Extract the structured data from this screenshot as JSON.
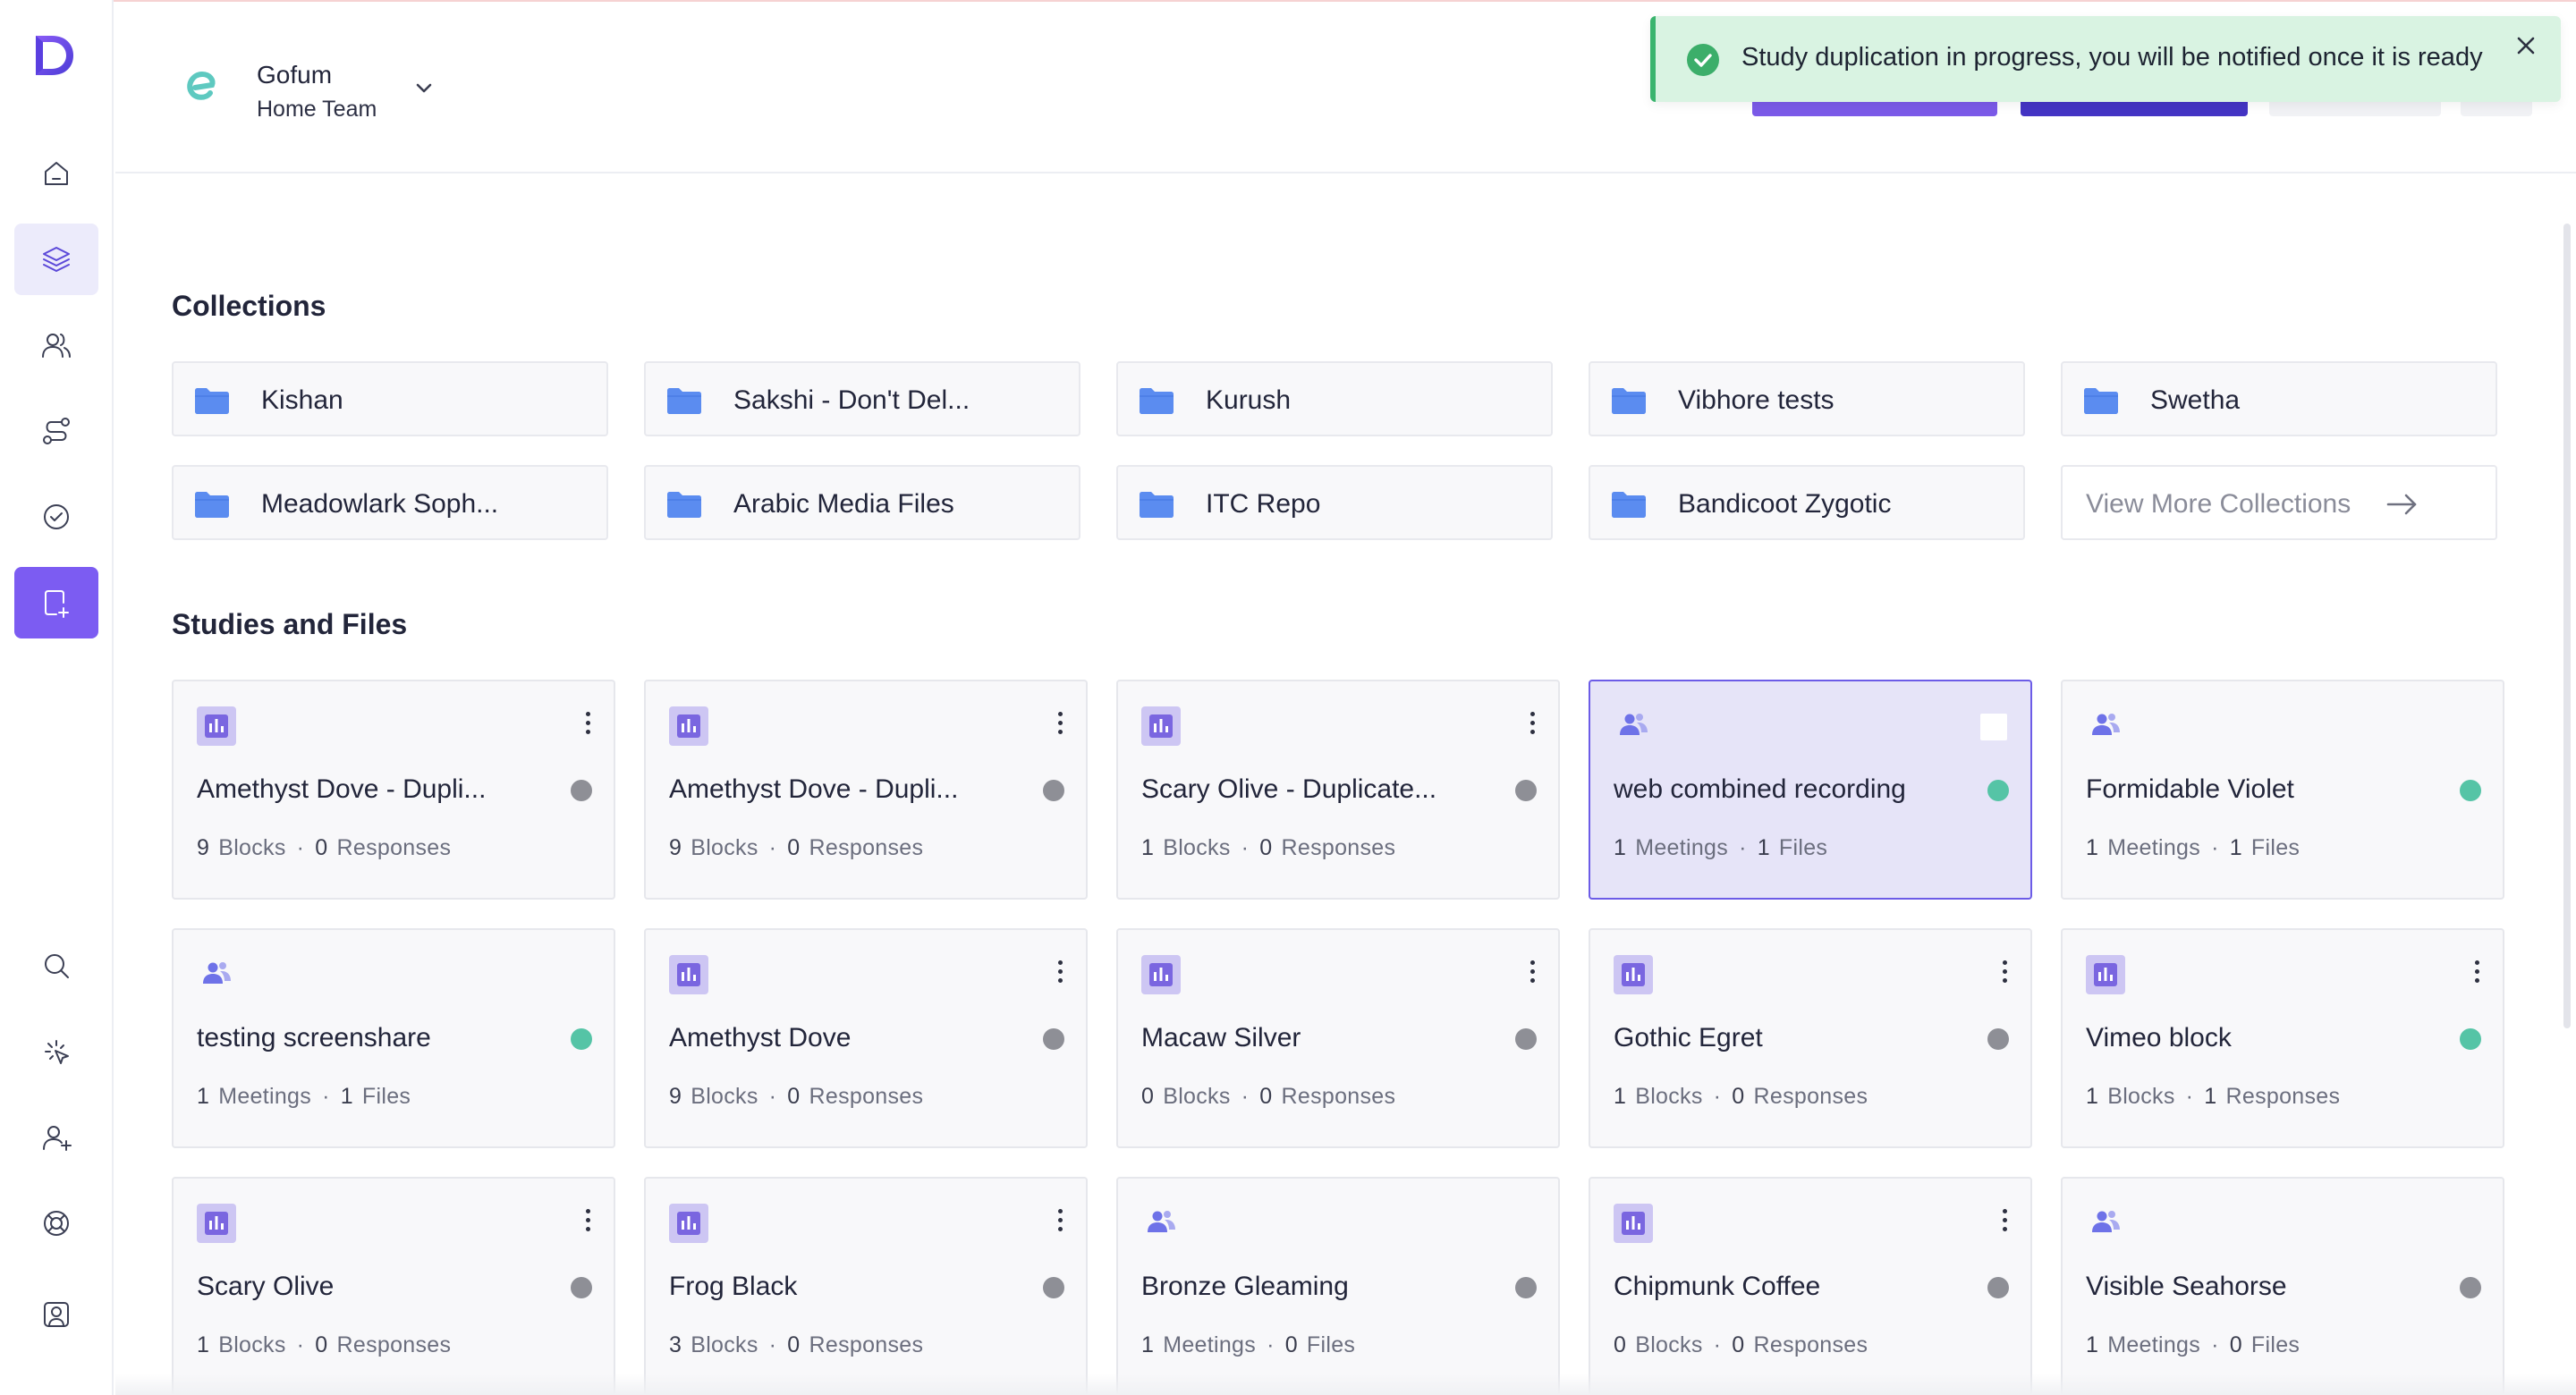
{
  "app": {
    "logo_letter": "D"
  },
  "team": {
    "name": "Gofum",
    "sub": "Home Team"
  },
  "toast": {
    "message": "Study duplication in progress, you will be notified once it is ready"
  },
  "sections": {
    "collections_title": "Collections",
    "studies_title": "Studies and Files"
  },
  "collections": [
    {
      "label": "Kishan"
    },
    {
      "label": "Sakshi - Don't Del..."
    },
    {
      "label": "Kurush"
    },
    {
      "label": "Vibhore tests"
    },
    {
      "label": "Swetha"
    },
    {
      "label": "Meadowlark Soph..."
    },
    {
      "label": "Arabic Media Files"
    },
    {
      "label": "ITC Repo"
    },
    {
      "label": "Bandicoot Zygotic"
    }
  ],
  "view_more": {
    "label": "View More Collections"
  },
  "colors": {
    "accent": "#7c5cf2",
    "dot_gray": "#8e8f96",
    "dot_green": "#55c4a6",
    "toast_bg": "#d9f3e2"
  },
  "studies": [
    {
      "title": "Amethyst Dove - Dupli...",
      "type": "chart-icon",
      "n1": "9",
      "u1": "Blocks",
      "n2": "0",
      "u2": "Responses",
      "status": "gray"
    },
    {
      "title": "Amethyst Dove - Dupli...",
      "type": "chart-icon",
      "n1": "9",
      "u1": "Blocks",
      "n2": "0",
      "u2": "Responses",
      "status": "gray"
    },
    {
      "title": "Scary Olive - Duplicate...",
      "type": "chart-icon",
      "n1": "1",
      "u1": "Blocks",
      "n2": "0",
      "u2": "Responses",
      "status": "gray"
    },
    {
      "title": "web combined recording",
      "type": "people-icon",
      "n1": "1",
      "u1": "Meetings",
      "n2": "1",
      "u2": "Files",
      "status": "green",
      "selected": true
    },
    {
      "title": "Formidable Violet",
      "type": "people-icon",
      "n1": "1",
      "u1": "Meetings",
      "n2": "1",
      "u2": "Files",
      "status": "green"
    },
    {
      "title": "testing screenshare",
      "type": "people-icon",
      "n1": "1",
      "u1": "Meetings",
      "n2": "1",
      "u2": "Files",
      "status": "green"
    },
    {
      "title": "Amethyst Dove",
      "type": "chart-icon",
      "n1": "9",
      "u1": "Blocks",
      "n2": "0",
      "u2": "Responses",
      "status": "gray"
    },
    {
      "title": "Macaw Silver",
      "type": "chart-icon",
      "n1": "0",
      "u1": "Blocks",
      "n2": "0",
      "u2": "Responses",
      "status": "gray"
    },
    {
      "title": "Gothic Egret",
      "type": "chart-icon",
      "n1": "1",
      "u1": "Blocks",
      "n2": "0",
      "u2": "Responses",
      "status": "gray"
    },
    {
      "title": "Vimeo block",
      "type": "chart-icon",
      "n1": "1",
      "u1": "Blocks",
      "n2": "1",
      "u2": "Responses",
      "status": "green"
    },
    {
      "title": "Scary Olive",
      "type": "chart-icon",
      "n1": "1",
      "u1": "Blocks",
      "n2": "0",
      "u2": "Responses",
      "status": "gray"
    },
    {
      "title": "Frog Black",
      "type": "chart-icon",
      "n1": "3",
      "u1": "Blocks",
      "n2": "0",
      "u2": "Responses",
      "status": "gray"
    },
    {
      "title": "Bronze Gleaming",
      "type": "people-icon",
      "n1": "1",
      "u1": "Meetings",
      "n2": "0",
      "u2": "Files",
      "status": "gray"
    },
    {
      "title": "Chipmunk Coffee",
      "type": "chart-icon",
      "n1": "0",
      "u1": "Blocks",
      "n2": "0",
      "u2": "Responses",
      "status": "gray"
    },
    {
      "title": "Visible Seahorse",
      "type": "people-icon",
      "n1": "1",
      "u1": "Meetings",
      "n2": "0",
      "u2": "Files",
      "status": "gray"
    }
  ]
}
